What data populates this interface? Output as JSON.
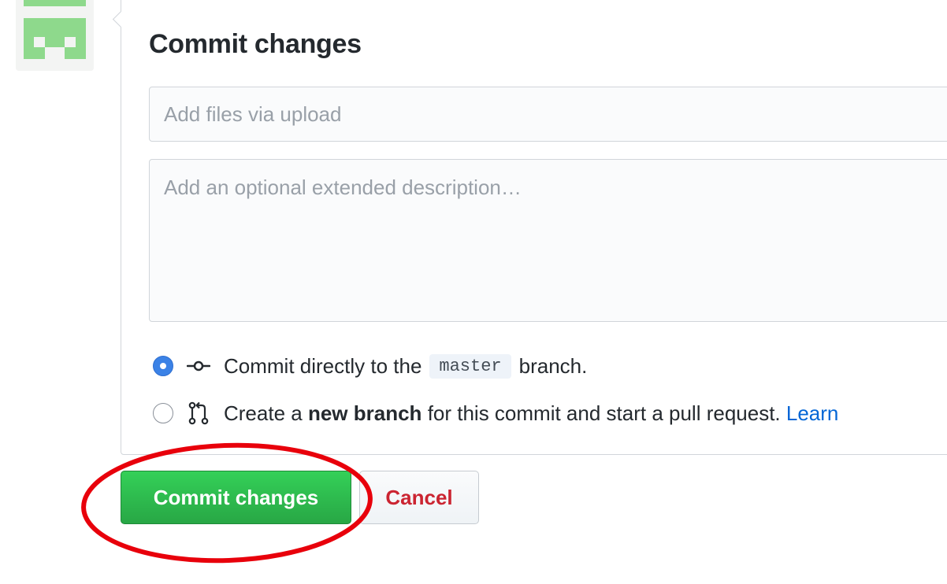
{
  "avatar": {
    "icon": "identicon",
    "color": "#8ed98c"
  },
  "commit_form": {
    "title": "Commit changes",
    "summary": {
      "value": "",
      "placeholder": "Add files via upload"
    },
    "description": {
      "value": "",
      "placeholder": "Add an optional extended description…"
    },
    "options": [
      {
        "selected": true,
        "icon": "git-commit-icon",
        "text_before": "Commit directly to the",
        "branch": "master",
        "text_after": "branch."
      },
      {
        "selected": false,
        "icon": "git-pull-request-icon",
        "text_before": "Create a",
        "emphasis": "new branch",
        "text_after": "for this commit and start a pull request.",
        "link": "Learn"
      }
    ]
  },
  "actions": {
    "commit_label": "Commit changes",
    "cancel_label": "Cancel"
  },
  "annotation": {
    "shape": "ellipse",
    "color": "#e8000b",
    "target": "commit-changes-button"
  },
  "colors": {
    "primary_button": "#2ea44f",
    "danger_text": "#cb2431",
    "link": "#0366d6",
    "radio_selected": "#3b82e6"
  }
}
